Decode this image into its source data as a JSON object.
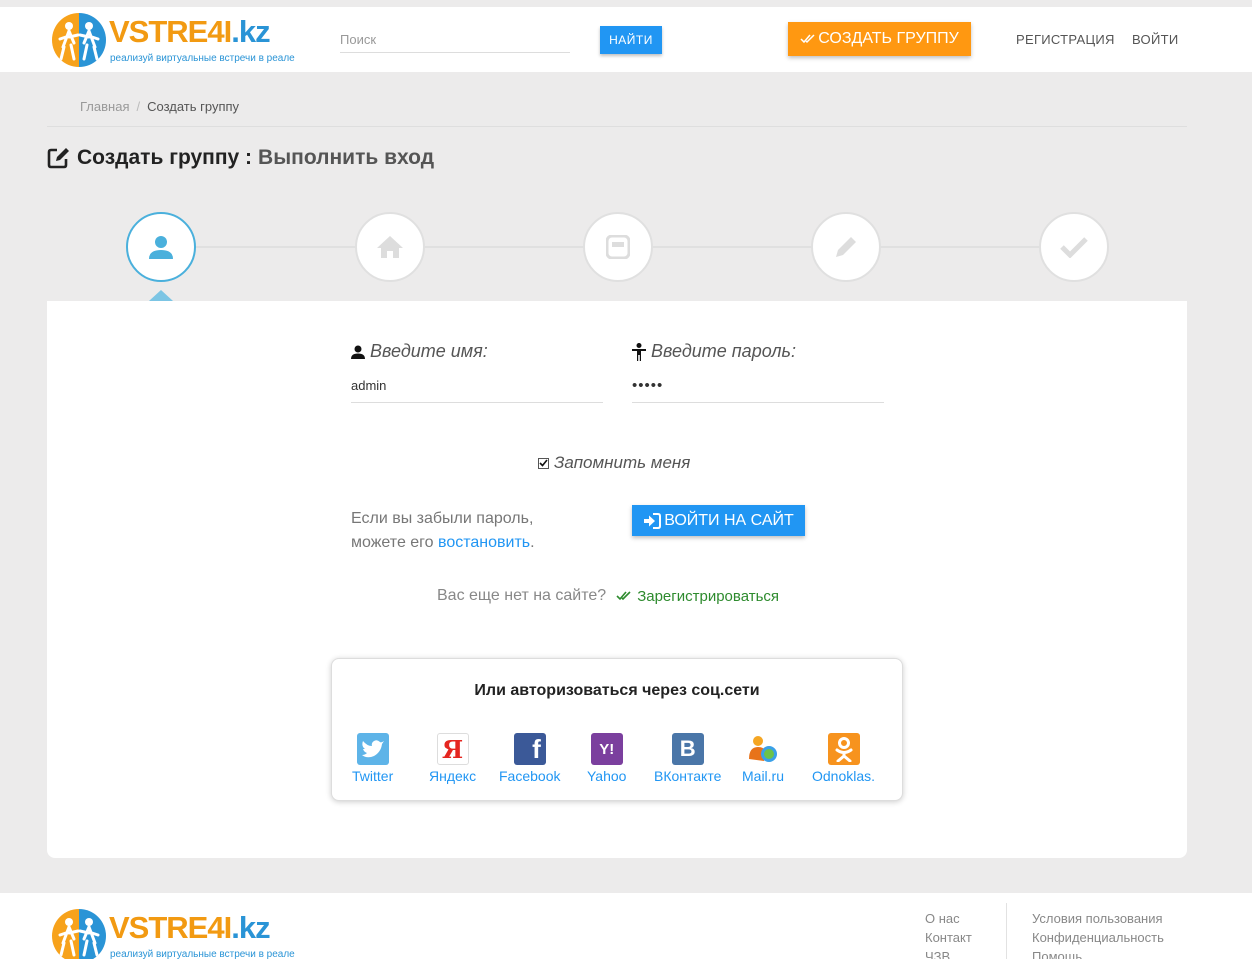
{
  "header": {
    "logo_text_main": "VSTRE4I",
    "logo_text_tld": ".kz",
    "slogan": "реализуй виртуальные встречи в реале",
    "search_placeholder": "Поиск",
    "find_button": "НАЙТИ",
    "create_group_button": "СОЗДАТЬ ГРУППУ",
    "nav": {
      "register": "РЕГИСТРАЦИЯ",
      "login": "ВОЙТИ"
    }
  },
  "breadcrumb": {
    "home": "Главная",
    "separator": "/",
    "current": "Создать группу"
  },
  "page": {
    "title": "Создать группу :",
    "subtitle": "Выполнить вход"
  },
  "steps": [
    {
      "icon": "user-icon",
      "active": true
    },
    {
      "icon": "home-icon",
      "active": false
    },
    {
      "icon": "card-icon",
      "active": false
    },
    {
      "icon": "pencil-icon",
      "active": false
    },
    {
      "icon": "check-icon",
      "active": false
    }
  ],
  "login_form": {
    "username_label": "Введите имя:",
    "username_value": "admin",
    "password_label": "Введите пароль:",
    "password_value": "•••••",
    "remember_label": "Запомнить меня",
    "remember_checked": true,
    "forgot_line1": "Если вы забыли пароль,",
    "forgot_line2": "можете его",
    "forgot_link": "востановить",
    "forgot_end": ".",
    "login_button": "ВОЙТИ НА САЙТ",
    "no_account": "Вас еще нет на сайте?",
    "register_link": "Зарегистрироваться"
  },
  "social": {
    "title": "Или авторизоваться через соц.сети",
    "providers": [
      {
        "name": "Twitter",
        "color": "#5eb4e8"
      },
      {
        "name": "Яндекс",
        "color": "#ffffff"
      },
      {
        "name": "Facebook",
        "color": "#3b5998"
      },
      {
        "name": "Yahoo",
        "color": "#7b3f9e"
      },
      {
        "name": "ВКонтакте",
        "color": "#4a76a8"
      },
      {
        "name": "Mail.ru",
        "color": "#f5a623"
      },
      {
        "name": "Odnoklas.",
        "color": "#f7931e"
      }
    ]
  },
  "footer": {
    "col1": [
      "О нас",
      "Контакт",
      "ЧЗВ"
    ],
    "col2": [
      "Условия пользования",
      "Конфиденциальность",
      "Помощь"
    ]
  },
  "colors": {
    "primary": "#2196f3",
    "accent": "#ff9811",
    "success": "#2e8b2e",
    "step_active": "#4ab0dc"
  }
}
